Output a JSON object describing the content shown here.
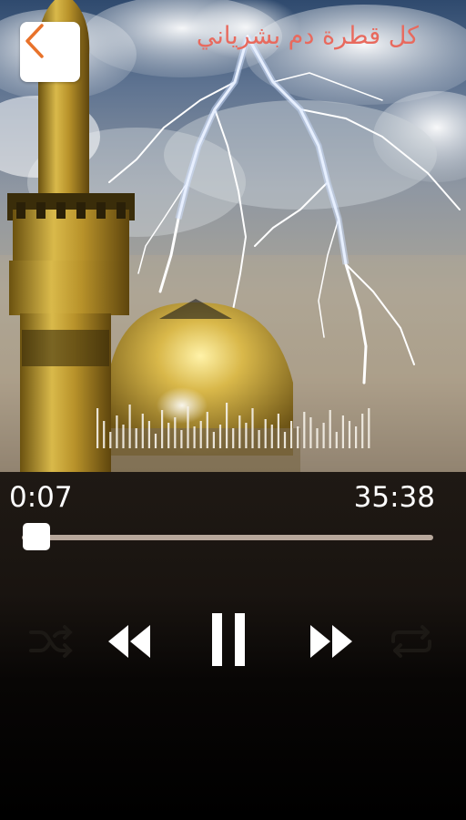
{
  "header": {
    "back_icon": "chevron-left-icon",
    "track_title": "كل قطرة دم بشرياني"
  },
  "colors": {
    "accent": "#e8722a",
    "title": "#e86a5e",
    "seek_track": "#b8a89c",
    "inactive_icon": "#1c1915"
  },
  "player": {
    "elapsed": "0:07",
    "total": "35:38",
    "progress": 0.003
  },
  "controls": {
    "shuffle_icon": "shuffle-icon",
    "previous_icon": "rewind-icon",
    "pause_icon": "pause-icon",
    "next_icon": "fast-forward-icon",
    "repeat_icon": "repeat-icon"
  }
}
